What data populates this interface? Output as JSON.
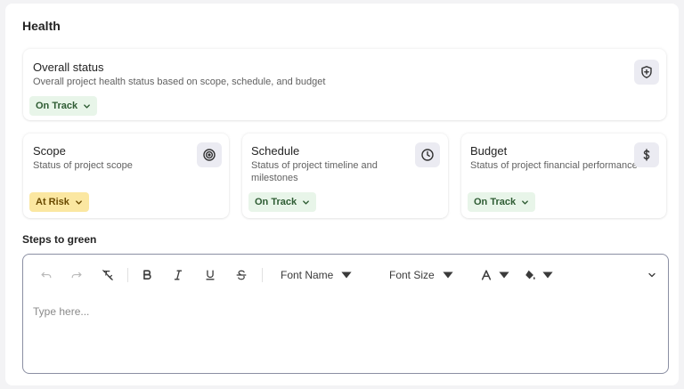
{
  "section": {
    "title": "Health"
  },
  "overall": {
    "title": "Overall status",
    "description": "Overall project health status based on scope, schedule, and budget",
    "status": "On Track",
    "icon": "shield-plus-icon"
  },
  "cards": [
    {
      "title": "Scope",
      "description": "Status of project scope",
      "status": "At Risk",
      "icon": "target-icon"
    },
    {
      "title": "Schedule",
      "description": "Status of project timeline and milestones",
      "status": "On Track",
      "icon": "clock-icon"
    },
    {
      "title": "Budget",
      "description": "Status of project financial performance",
      "status": "On Track",
      "icon": "dollar-icon"
    }
  ],
  "steps": {
    "label": "Steps to green",
    "placeholder": "Type here...",
    "toolbar": {
      "font_name": "Font Name",
      "font_size": "Font Size"
    }
  },
  "colors": {
    "on_track_bg": "#e8f5e9",
    "on_track_text": "#2e5c33",
    "at_risk_bg": "#fbe7a1",
    "at_risk_text": "#6a4a00",
    "icon_box_bg": "#ebebf2",
    "editor_border": "#8b8fa3"
  }
}
